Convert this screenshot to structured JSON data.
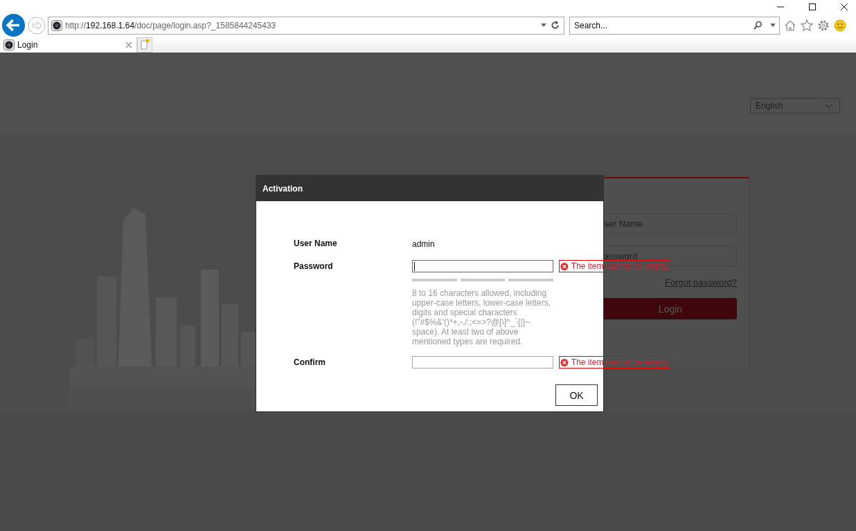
{
  "browser": {
    "address": {
      "prefix": "http://",
      "host": "192.168.1.64",
      "path": "/doc/page/login.asp?_1585844245433"
    },
    "search": {
      "placeholder": "Search..."
    },
    "tabs": [
      {
        "title": "Login",
        "selected": true
      }
    ]
  },
  "page": {
    "language": "English",
    "login_card": {
      "username_placeholder": "ser Name",
      "password_placeholder": "assword",
      "forgot_link": "Forgot password?",
      "login_button": "Login"
    }
  },
  "dialog": {
    "title": "Activation",
    "rows": [
      {
        "kind": "text",
        "label": "User Name",
        "value": "admin"
      },
      {
        "kind": "password",
        "label": "Password",
        "focused": true,
        "error": "The item cannot be empty.",
        "strength_meter": true,
        "hint": "8 to 16 characters allowed, including upper-case letters, lower-case letters, digits and special characters (!\"#$%&'()*+,-./:;<=>?@[\\]^_`{|}~ space). At least two of above mentioned types are required."
      },
      {
        "kind": "password",
        "label": "Confirm",
        "focused": false,
        "error": "The item cannot be empty."
      }
    ],
    "ok_button": "OK"
  }
}
